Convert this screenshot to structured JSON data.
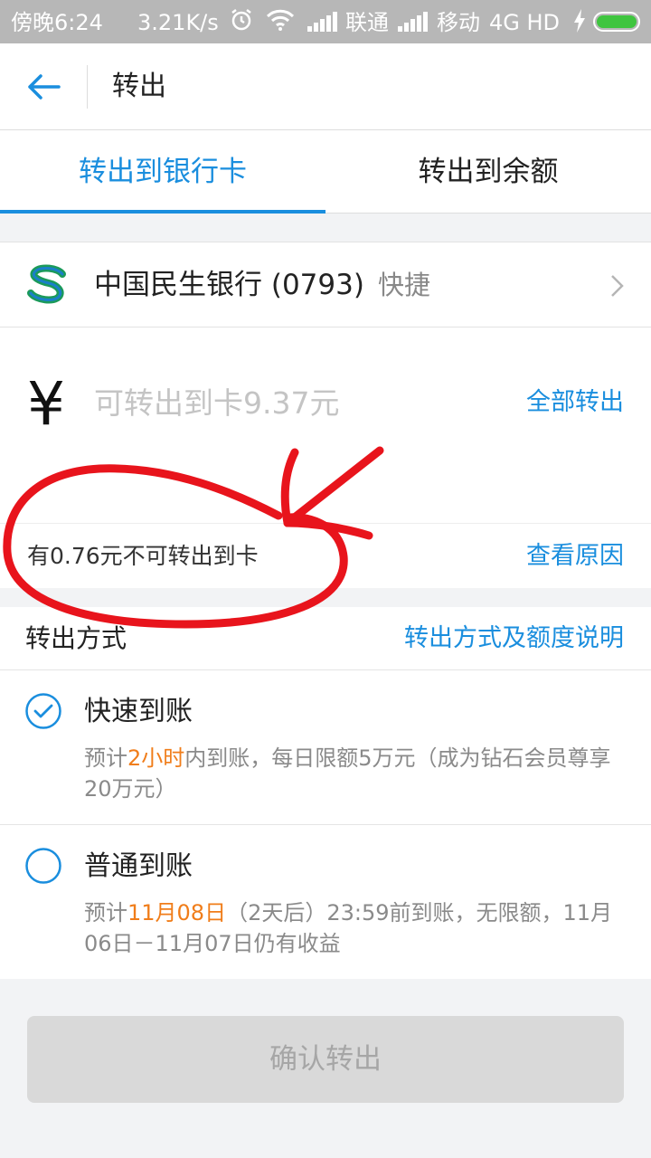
{
  "status_bar": {
    "time": "傍晚6:24",
    "speed": "3.21K/s",
    "carrier1": "联通",
    "carrier2": "移动",
    "network": "4G HD",
    "battery_level": 1.0,
    "battery_color": "#3fc53f"
  },
  "nav": {
    "title": "转出"
  },
  "tabs": [
    {
      "label": "转出到银行卡",
      "active": true
    },
    {
      "label": "转出到余额",
      "active": false
    }
  ],
  "bank": {
    "name": "中国民生银行 (0793)",
    "tag": "快捷",
    "logo_icon": "minsheng-bank-logo"
  },
  "amount": {
    "currency_symbol": "¥",
    "placeholder": "可转出到卡9.37元",
    "value": "",
    "all_out_label": "全部转出"
  },
  "notice": {
    "text": "有0.76元不可转出到卡",
    "link_label": "查看原因"
  },
  "methods": {
    "title": "转出方式",
    "info_link": "转出方式及额度说明",
    "options": [
      {
        "title": "快速到账",
        "checked": true,
        "desc_prefix": "预计",
        "desc_highlight": "2小时",
        "desc_suffix": "内到账，每日限额5万元（成为钻石会员尊享20万元）"
      },
      {
        "title": "普通到账",
        "checked": false,
        "desc_prefix": "预计",
        "desc_highlight": "11月08日",
        "desc_suffix": "（2天后）23:59前到账，无限额，11月06日－11月07日仍有收益"
      }
    ]
  },
  "confirm_label": "确认转出",
  "colors": {
    "accent": "#1a8ede",
    "highlight": "#f07d1a",
    "annotation": "#e8141c",
    "disabled_button": "#d9d9d9"
  }
}
